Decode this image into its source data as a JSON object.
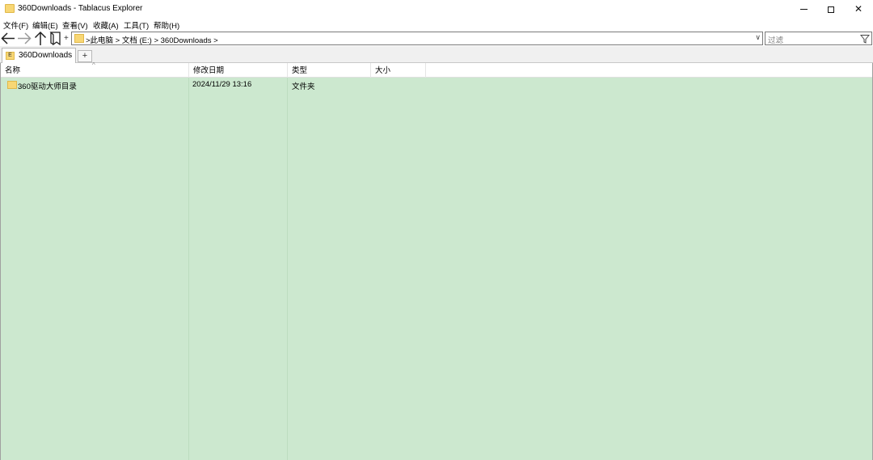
{
  "window": {
    "title": "360Downloads - Tablacus Explorer",
    "folder_icon": "folder-icon"
  },
  "menu": {
    "items": [
      "文件(F)",
      "编辑(E)",
      "查看(V)",
      "收藏(A)",
      "工具(T)",
      "帮助(H)"
    ]
  },
  "toolbar": {
    "plus": "+"
  },
  "address": {
    "crumbs": ">此电脑 > 文档 (E:) > 360Downloads >",
    "dropdown": "∨"
  },
  "filter": {
    "placeholder": "过滤"
  },
  "tabs": {
    "active_label": "360Downloads",
    "active_icon_letter": "E",
    "add_label": "+"
  },
  "list": {
    "columns": [
      "名称",
      "修改日期",
      "类型",
      "大小"
    ],
    "sort_indicator": "^",
    "rows": [
      {
        "name": "360驱动大师目录",
        "modified": "2024/11/29 13:16",
        "type": "文件夹",
        "size": ""
      }
    ]
  },
  "colors": {
    "list_background": "#cce8cf",
    "folder": "#f8d775"
  }
}
